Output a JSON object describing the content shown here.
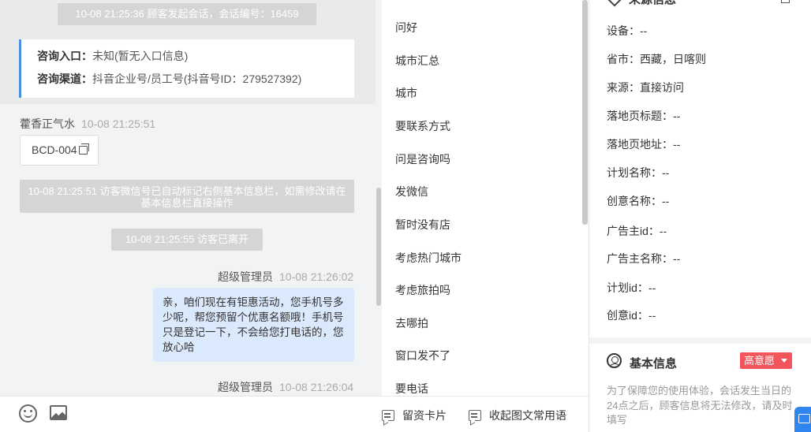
{
  "chat": {
    "session_start": "10-08 21:25:36 顾客发起会话，会话编号：16459",
    "entry_label": "咨询入口：",
    "entry_value": "未知(暂无入口信息)",
    "channel_label": "咨询渠道：",
    "channel_value": "抖音企业号/员工号(抖音号ID：279527392)",
    "visitor_name": "藿香正气水",
    "visitor_time": "10-08 21:25:51",
    "tag_text": "BCD-004",
    "auto_tag_notice": "10-08 21:25:51 访客微信号已自动标记右侧基本信息栏，如需修改请在基本信息栏直接操作",
    "visitor_left": "10-08 21:25:55 访客已离开",
    "agent_name": "超级管理员",
    "agent_time_1": "10-08 21:26:02",
    "agent_message": "亲，咱们现在有钜惠活动，您手机号多少呢，帮您预留个优惠名额哦！手机号只是登记一下，不会给您打电话的，您放心哈",
    "agent_time_2": "10-08 21:26:04",
    "toolbar": {
      "emoji_icon": "emoji-icon",
      "image_icon": "image-icon"
    }
  },
  "quick_replies": {
    "items": [
      "问好",
      "城市汇总",
      "城市",
      "要联系方式",
      "问是咨询吗",
      "发微信",
      "暂时没有店",
      "考虑热门城市",
      "考虑旅拍吗",
      "去哪拍",
      "窗口发不了",
      "要电话"
    ],
    "actions": {
      "card": "留资卡片",
      "collapse": "收起图文常用语"
    }
  },
  "info_panel": {
    "source_title": "来源信息",
    "fields": [
      {
        "label": "设备：",
        "value": "--"
      },
      {
        "label": "省市：",
        "value": "西藏，日喀则"
      },
      {
        "label": "来源：",
        "value": "直接访问"
      },
      {
        "label": "落地页标题：",
        "value": "--"
      },
      {
        "label": "落地页地址：",
        "value": "--"
      },
      {
        "label": "计划名称：",
        "value": "--"
      },
      {
        "label": "创意名称：",
        "value": "--"
      },
      {
        "label": "广告主id：",
        "value": "--"
      },
      {
        "label": "广告主名称：",
        "value": "--"
      },
      {
        "label": "计划id：",
        "value": "--"
      },
      {
        "label": "创意id：",
        "value": "--"
      }
    ],
    "basic_title": "基本信息",
    "intent": "高意愿",
    "notice": "为了保障您的使用体验，会话发生当日的24点之后，顾客信息将无法修改，请及时填写"
  },
  "colors": {
    "accent_blue": "#4a90e2",
    "bubble_blue": "#dbe9fc",
    "badge_red": "#f2545b"
  }
}
